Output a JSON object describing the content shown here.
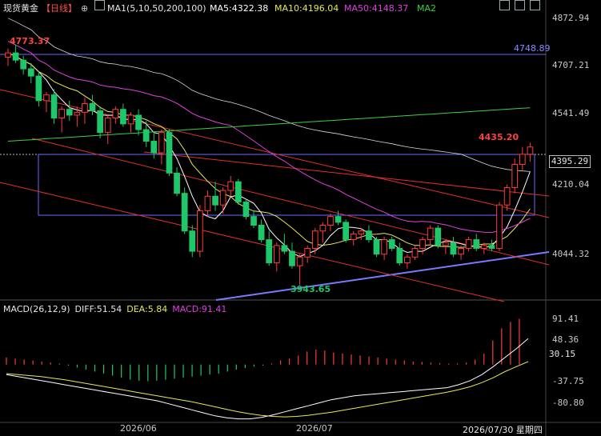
{
  "header": {
    "instrument": "现货黄金",
    "period": "【日线】",
    "ma_params": "MA1(5,10,50,200,100)",
    "ma5": "MA5:4322.38",
    "ma10": "MA10:4196.04",
    "ma50": "MA50:4148.37",
    "ma2": "MA2"
  },
  "macd_header": {
    "title": "MACD(26,12,9)",
    "diff": "DIFF:51.54",
    "dea": "DEA:5.84",
    "macd": "MACD:91.41"
  },
  "price_axis": [
    "4872.94",
    "4707.21",
    "4541.49",
    "4210.04",
    "4044.32"
  ],
  "current_price": "4395.29",
  "macd_axis": [
    "91.41",
    "48.36",
    "-37.75",
    "-80.80"
  ],
  "macd_current": "30.15",
  "x_axis": [
    "2026/06",
    "2026/07",
    "2026/07/30 星期四"
  ],
  "annotations": {
    "high": "4773.37",
    "low": "3943.65",
    "recent_high": "4435.20",
    "box_top": "4748.89"
  },
  "colors": {
    "up": "#ff3b3b",
    "down": "#1ec86a",
    "ma5": "#ffffff",
    "ma10": "#e8e85a",
    "ma50": "#e040e0",
    "ma100": "#d8d8d8",
    "ma200": "#3fcf3f",
    "box": "#6a6aff",
    "trend": "#e03030"
  },
  "chart_data": {
    "type": "candlestick",
    "price_range": [
      3900,
      4900
    ],
    "candles": [
      [
        4730,
        4760,
        4700,
        4745
      ],
      [
        4745,
        4773,
        4710,
        4720
      ],
      [
        4720,
        4735,
        4670,
        4690
      ],
      [
        4690,
        4710,
        4640,
        4665
      ],
      [
        4665,
        4680,
        4560,
        4580
      ],
      [
        4580,
        4610,
        4540,
        4600
      ],
      [
        4600,
        4620,
        4500,
        4520
      ],
      [
        4520,
        4560,
        4470,
        4550
      ],
      [
        4550,
        4580,
        4510,
        4530
      ],
      [
        4530,
        4560,
        4490,
        4540
      ],
      [
        4540,
        4590,
        4500,
        4570
      ],
      [
        4570,
        4600,
        4530,
        4545
      ],
      [
        4545,
        4560,
        4450,
        4470
      ],
      [
        4470,
        4530,
        4430,
        4520
      ],
      [
        4520,
        4560,
        4500,
        4550
      ],
      [
        4550,
        4570,
        4490,
        4500
      ],
      [
        4500,
        4540,
        4470,
        4530
      ],
      [
        4530,
        4550,
        4460,
        4480
      ],
      [
        4480,
        4510,
        4420,
        4440
      ],
      [
        4440,
        4470,
        4380,
        4400
      ],
      [
        4400,
        4480,
        4360,
        4470
      ],
      [
        4470,
        4480,
        4320,
        4330
      ],
      [
        4330,
        4350,
        4250,
        4260
      ],
      [
        4260,
        4280,
        4120,
        4130
      ],
      [
        4130,
        4150,
        4040,
        4060
      ],
      [
        4060,
        4220,
        4040,
        4200
      ],
      [
        4200,
        4270,
        4180,
        4250
      ],
      [
        4250,
        4300,
        4200,
        4220
      ],
      [
        4220,
        4280,
        4190,
        4270
      ],
      [
        4270,
        4320,
        4250,
        4300
      ],
      [
        4300,
        4310,
        4220,
        4230
      ],
      [
        4230,
        4240,
        4170,
        4180
      ],
      [
        4180,
        4200,
        4140,
        4150
      ],
      [
        4150,
        4170,
        4090,
        4100
      ],
      [
        4100,
        4130,
        4010,
        4020
      ],
      [
        4020,
        4090,
        3990,
        4080
      ],
      [
        4080,
        4120,
        4050,
        4060
      ],
      [
        4060,
        4090,
        4000,
        4010
      ],
      [
        4010,
        4050,
        3943,
        4040
      ],
      [
        4040,
        4080,
        4020,
        4070
      ],
      [
        4070,
        4140,
        4050,
        4130
      ],
      [
        4130,
        4160,
        4090,
        4150
      ],
      [
        4150,
        4190,
        4130,
        4180
      ],
      [
        4180,
        4200,
        4150,
        4160
      ],
      [
        4160,
        4170,
        4090,
        4100
      ],
      [
        4100,
        4130,
        4080,
        4120
      ],
      [
        4120,
        4140,
        4100,
        4130
      ],
      [
        4130,
        4150,
        4090,
        4100
      ],
      [
        4100,
        4110,
        4040,
        4050
      ],
      [
        4050,
        4110,
        4030,
        4100
      ],
      [
        4100,
        4110,
        4060,
        4070
      ],
      [
        4070,
        4090,
        4010,
        4020
      ],
      [
        4020,
        4050,
        4000,
        4040
      ],
      [
        4040,
        4080,
        4030,
        4070
      ],
      [
        4070,
        4110,
        4050,
        4100
      ],
      [
        4100,
        4150,
        4080,
        4140
      ],
      [
        4140,
        4150,
        4070,
        4080
      ],
      [
        4080,
        4100,
        4050,
        4090
      ],
      [
        4090,
        4110,
        4040,
        4050
      ],
      [
        4050,
        4080,
        4030,
        4070
      ],
      [
        4070,
        4110,
        4060,
        4100
      ],
      [
        4100,
        4120,
        4060,
        4070
      ],
      [
        4070,
        4090,
        4050,
        4080
      ],
      [
        4080,
        4100,
        4060,
        4070
      ],
      [
        4070,
        4230,
        4060,
        4220
      ],
      [
        4220,
        4290,
        4200,
        4280
      ],
      [
        4280,
        4380,
        4260,
        4360
      ],
      [
        4360,
        4420,
        4340,
        4395
      ],
      [
        4395,
        4435,
        4370,
        4420
      ]
    ],
    "macd_hist": [
      14,
      12,
      10,
      8,
      6,
      4,
      2,
      -2,
      -6,
      -10,
      -14,
      -18,
      -22,
      -26,
      -30,
      -32,
      -33,
      -32,
      -30,
      -28,
      -26,
      -24,
      -22,
      -20,
      -18,
      -14,
      -10,
      -7,
      -4,
      -2,
      2,
      8,
      12,
      18,
      26,
      30,
      28,
      24,
      22,
      20,
      18,
      16,
      14,
      12,
      10,
      8,
      6,
      5,
      4,
      3,
      2,
      2,
      4,
      10,
      22,
      48,
      72,
      85,
      91
    ],
    "dif": [
      -20,
      -24,
      -28,
      -32,
      -36,
      -40,
      -44,
      -48,
      -52,
      -56,
      -60,
      -64,
      -68,
      -72,
      -78,
      -84,
      -90,
      -96,
      -102,
      -106,
      -108,
      -108,
      -105,
      -100,
      -94,
      -88,
      -82,
      -76,
      -70,
      -66,
      -62,
      -60,
      -58,
      -56,
      -54,
      -52,
      -50,
      -48,
      -46,
      -40,
      -32,
      -20,
      -4,
      14,
      32,
      51.54
    ],
    "dea": [
      -18,
      -20,
      -22,
      -24,
      -27,
      -30,
      -34,
      -38,
      -42,
      -46,
      -50,
      -54,
      -58,
      -62,
      -66,
      -70,
      -74,
      -79,
      -84,
      -89,
      -94,
      -98,
      -101,
      -103,
      -104,
      -103,
      -101,
      -98,
      -95,
      -91,
      -87,
      -83,
      -79,
      -75,
      -71,
      -67,
      -63,
      -59,
      -55,
      -50,
      -44,
      -36,
      -26,
      -14,
      -4,
      5.84
    ],
    "series": [
      {
        "name": "MA5"
      },
      {
        "name": "MA10"
      },
      {
        "name": "MA50"
      }
    ]
  }
}
